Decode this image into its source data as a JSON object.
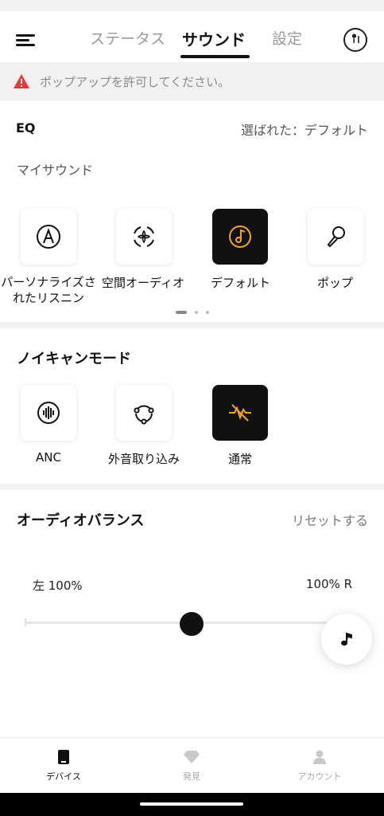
{
  "header": {
    "tabs": [
      {
        "label": "ステータス"
      },
      {
        "label": "サウンド"
      },
      {
        "label": "設定"
      }
    ],
    "active_tab": "サウンド"
  },
  "popup_banner": {
    "text": "ポップアップを許可してください。",
    "icon": "warning-icon",
    "icon_color": "#e53935"
  },
  "eq": {
    "title": "EQ",
    "selected_label": "選ばれた：デフォルト",
    "subtitle": "マイサウンド",
    "presets": [
      {
        "label": "パーソナライズされたリスニン",
        "icon": "personalized-a-icon"
      },
      {
        "label": "空間オーディオ",
        "icon": "spatial-audio-icon"
      },
      {
        "label": "デフォルト",
        "icon": "music-disc-icon"
      },
      {
        "label": "ポップ",
        "icon": "microphone-icon"
      }
    ],
    "active_preset": "デフォルト",
    "page_count": 3,
    "active_page": 1
  },
  "noise_control": {
    "title": "ノイキャンモード",
    "modes": [
      {
        "label": "ANC",
        "icon": "anc-icon"
      },
      {
        "label": "外音取り込み",
        "icon": "ambient-icon"
      },
      {
        "label": "通常",
        "icon": "normal-mode-icon"
      }
    ],
    "active_mode": "通常"
  },
  "audio_balance": {
    "title": "オーディオバランス",
    "reset_label": "リセットする",
    "left_label": "左 100%",
    "right_label": "100% R",
    "balance_position": 0.5
  },
  "bottom_nav": {
    "items": [
      {
        "label": "デバイス",
        "icon": "device-icon"
      },
      {
        "label": "発見",
        "icon": "diamond-icon"
      },
      {
        "label": "アカウント",
        "icon": "person-icon"
      }
    ],
    "active": "デバイス"
  },
  "colors": {
    "accent": "#f5a623",
    "active_tile": "#111111",
    "warning": "#e53935"
  }
}
